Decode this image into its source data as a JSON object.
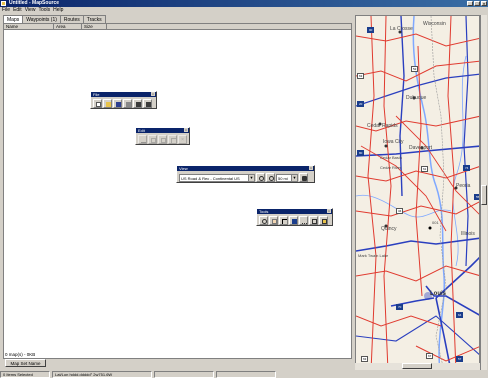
{
  "window": {
    "title": "Untitled - MapSource"
  },
  "menu": [
    "File",
    "Edit",
    "View",
    "Tools",
    "Help"
  ],
  "tabs": [
    {
      "label": "Maps",
      "active": true
    },
    {
      "label": "Waypoints (1)",
      "active": false
    },
    {
      "label": "Routes",
      "active": false
    },
    {
      "label": "Tracks",
      "active": false
    }
  ],
  "columns": [
    "Name",
    "Area",
    "Size"
  ],
  "maps_status": "0 map(s) - 0KB",
  "set_name_button": "Map Set Name",
  "toolbars": {
    "file": {
      "title": "File"
    },
    "edit": {
      "title": "Edit"
    },
    "view": {
      "title": "View",
      "product": "US Road & Rec - Continental US",
      "zoom": "50 mi"
    },
    "tools": {
      "title": "Tools"
    }
  },
  "status": {
    "selection": "0 Items Selected",
    "position": "Lat/Lon hddd.ddddd° 2w751.6W"
  },
  "map": {
    "labels": [
      {
        "text": "Wisconsin",
        "bold": false
      },
      {
        "text": "La Crosse",
        "bold": false
      },
      {
        "text": "Dubuque",
        "bold": false
      },
      {
        "text": "Cedar Rapids",
        "bold": false
      },
      {
        "text": "Iowa City",
        "bold": false
      },
      {
        "text": "Davenport",
        "bold": false
      },
      {
        "text": "Cedar Basin",
        "bold": false
      },
      {
        "text": "Cedar River",
        "bold": false
      },
      {
        "text": "Peoria",
        "bold": false
      },
      {
        "text": "Illinois",
        "bold": false
      },
      {
        "text": "Quincy",
        "bold": false
      },
      {
        "text": "001",
        "bold": false
      },
      {
        "text": "Louis",
        "bold": true
      },
      {
        "text": "Mark Twain Lake",
        "bold": false
      }
    ],
    "colors": {
      "interstate": "#2a3fbf",
      "highway": "#e03a2f",
      "river": "#7fa8ff",
      "land": "#f4efe4"
    }
  }
}
